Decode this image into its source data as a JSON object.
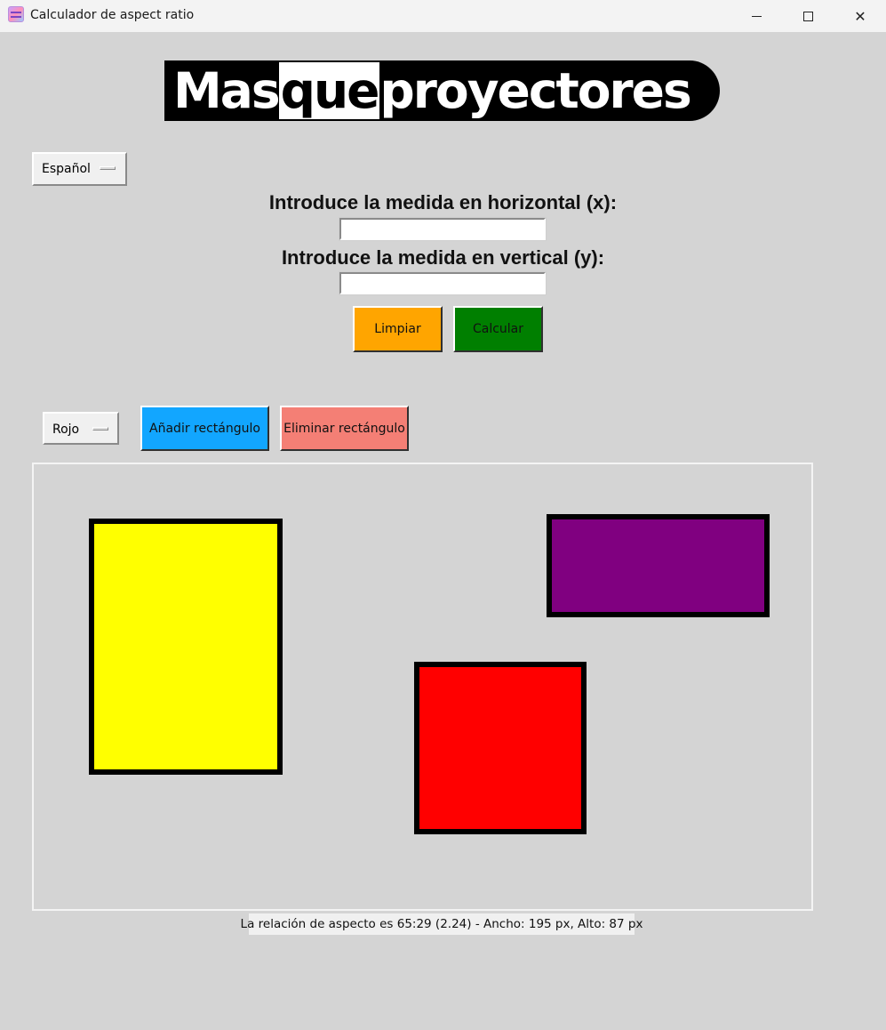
{
  "window": {
    "title": "Calculador de aspect ratio",
    "app_icon": "app-icon",
    "controls": [
      "minimize-icon",
      "maximize-icon",
      "close-icon"
    ]
  },
  "logo": {
    "part1": "Mas",
    "part2": "que",
    "part3": "proyectores"
  },
  "language_menu": {
    "selected": "Español"
  },
  "form": {
    "label_x": "Introduce la medida en horizontal (x):",
    "label_y": "Introduce la medida en vertical (y):",
    "value_x": "",
    "value_y": ""
  },
  "buttons": {
    "clear": "Limpiar",
    "calculate": "Calcular",
    "add_rect": "Añadir rectángulo",
    "remove_rect": "Eliminar rectángulo"
  },
  "color_menu": {
    "selected": "Rojo"
  },
  "canvas": {
    "rectangles": [
      {
        "name": "yellow-rectangle",
        "fill": "#ffff00"
      },
      {
        "name": "purple-rectangle",
        "fill": "#800080"
      },
      {
        "name": "red-rectangle",
        "fill": "#ff0000"
      }
    ]
  },
  "result": "La relación de aspecto es 65:29 (2.24) - Ancho: 195 px, Alto: 87 px",
  "colors": {
    "background": "#d4d4d4",
    "clear_button": "#ffa500",
    "calculate_button": "#007f00",
    "add_button": "#12a6ff",
    "remove_button": "#f47f75"
  }
}
